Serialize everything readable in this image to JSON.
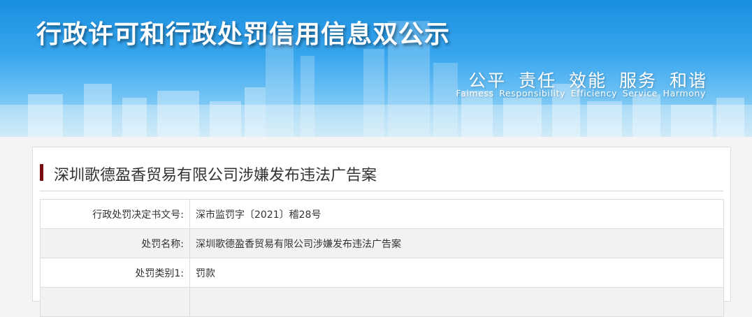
{
  "banner": {
    "title": "行政许可和行政处罚信用信息双公示",
    "slogan_cn": "公平 责任 效能 服务 和谐",
    "slogan_en": "Faimess Responsibility Efficiency Service Harmony"
  },
  "case": {
    "title": "深圳歌德盈香贸易有限公司涉嫌发布违法广告案"
  },
  "table": {
    "rows": [
      {
        "label": "行政处罚决定书文号:",
        "value": "深市监罚字〔2021〕稽28号"
      },
      {
        "label": "处罚名称:",
        "value": "深圳歌德盈香贸易有限公司涉嫌发布违法广告案"
      },
      {
        "label": "处罚类别1:",
        "value": "罚款"
      },
      {
        "label": "",
        "value": ""
      }
    ]
  },
  "colors": {
    "accent": "#7a0e0e",
    "banner_top": "#1a8fe0",
    "banner_bottom": "#b8e0f3"
  }
}
